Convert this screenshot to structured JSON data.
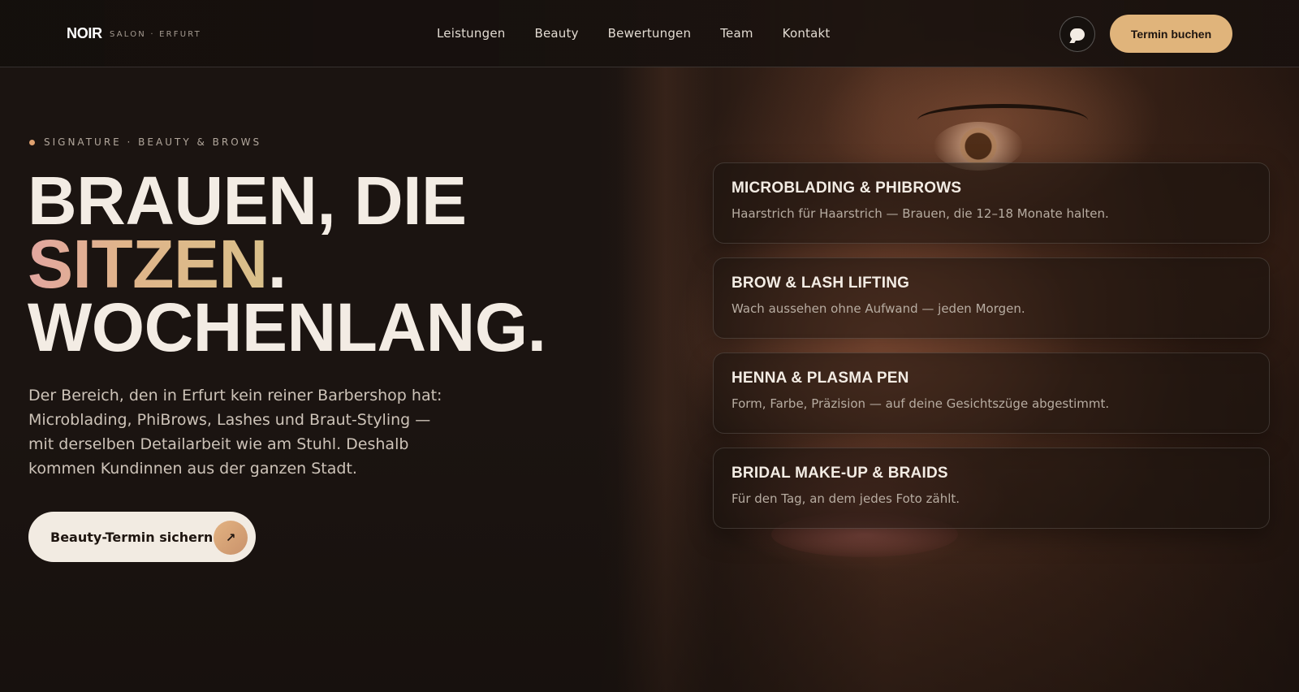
{
  "brand": {
    "logo": "NOIR",
    "subtitle": "SALON · ERFURT"
  },
  "nav": {
    "links": [
      "Leistungen",
      "Beauty",
      "Bewertungen",
      "Team",
      "Kontakt"
    ],
    "chat_icon": "chat-bubble-icon",
    "book_label": "Termin buchen"
  },
  "hero": {
    "eyebrow": "SIGNATURE · BEAUTY & BROWS",
    "headline_line1": "BRAUEN, DIE",
    "headline_accent": "SITZEN",
    "headline_period": ".",
    "headline_line3": "WOCHENLANG.",
    "lead": "Der Bereich, den in Erfurt kein reiner Barbershop hat: Microblading, PhiBrows, Lashes und Braut-Styling — mit derselben Detailarbeit wie am Stuhl. Deshalb kommen Kundinnen aus der ganzen Stadt.",
    "cta_label": "Beauty-Termin sichern",
    "cta_icon": "arrow-up-right-icon"
  },
  "services": [
    {
      "title": "MICROBLADING & PHIBROWS",
      "desc": "Haarstrich für Haarstrich — Brauen, die 12–18 Monate halten."
    },
    {
      "title": "BROW & LASH LIFTING",
      "desc": "Wach aussehen ohne Aufwand — jeden Morgen."
    },
    {
      "title": "HENNA & PLASMA PEN",
      "desc": "Form, Farbe, Präzision — auf deine Gesichtszüge abgestimmt."
    },
    {
      "title": "BRIDAL MAKE-UP & BRAIDS",
      "desc": "Für den Tag, an dem jedes Foto zählt."
    }
  ],
  "colors": {
    "accent": "#e0b47b",
    "background": "#1a1310",
    "text": "#f3ece4"
  }
}
